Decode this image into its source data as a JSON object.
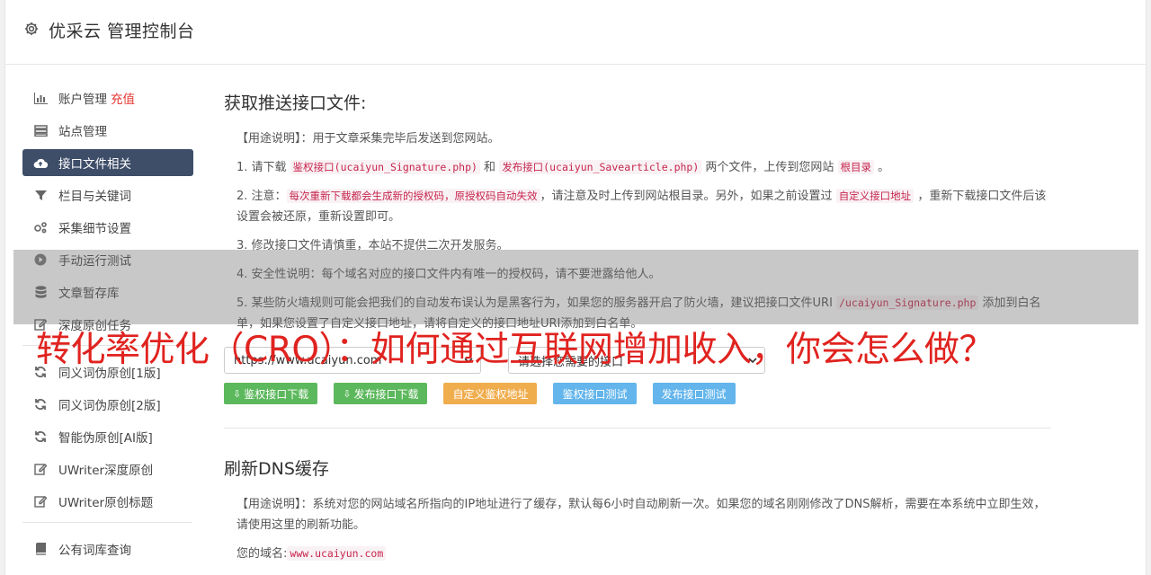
{
  "header": {
    "title": "优采云 管理控制台",
    "icon": "gear-icon"
  },
  "sidebar": {
    "items": [
      {
        "label": "账户管理",
        "extra": "充值",
        "icon": "bar-chart-icon"
      },
      {
        "label": "站点管理",
        "icon": "server-icon"
      },
      {
        "label": "接口文件相关",
        "icon": "cloud-upload-icon",
        "active": true
      },
      {
        "label": "栏目与关键词",
        "icon": "filter-icon"
      },
      {
        "label": "采集细节设置",
        "icon": "cogs-icon"
      },
      {
        "label": "手动运行测试",
        "icon": "play-circle-icon"
      },
      {
        "label": "文章暂存库",
        "icon": "database-icon"
      },
      {
        "label": "深度原创任务",
        "icon": "edit-icon"
      },
      {
        "label": "同义词伪原创[1版]",
        "icon": "refresh-icon"
      },
      {
        "label": "同义词伪原创[2版]",
        "icon": "refresh-icon"
      },
      {
        "label": "智能伪原创[AI版]",
        "icon": "refresh-icon"
      },
      {
        "label": "UWriter深度原创",
        "icon": "edit-icon"
      },
      {
        "label": "UWriter原创标题",
        "icon": "edit-icon"
      },
      {
        "label": "公有词库查询",
        "icon": "book-icon"
      }
    ]
  },
  "section1": {
    "title": "获取推送接口文件:",
    "usage_label": "【用途说明】",
    "usage_text": "：用于文章采集完毕后发送到您网站。",
    "p1_a": "1. 请下载 ",
    "p1_code1": "鉴权接口(ucaiyun_Signature.php)",
    "p1_b": " 和 ",
    "p1_code2": "发布接口(ucaiyun_Savearticle.php)",
    "p1_c": " 两个文件，上传到您网站 ",
    "p1_code3": "根目录",
    "p1_d": " 。",
    "p2_a": "2. 注意：",
    "p2_code1": "每次重新下载都会生成新的授权码，原授权码自动失效",
    "p2_b": "，请注意及时上传到网站根目录。另外，如果之前设置过 ",
    "p2_code2": "自定义接口地址",
    "p2_c": " ，重新下载接口文件后该设置会被还原，重新设置即可。",
    "p3": "3. 修改接口文件请慎重，本站不提供二次开发服务。",
    "p4": "4. 安全性说明：每个域名对应的接口文件内有唯一的授权码，请不要泄露给他人。",
    "p5_a": "5. 某些防火墙规则可能会把我们的自动发布误认为是黑客行为，如果您的服务器开启了防火墙，建议把接口文件URI ",
    "p5_code": "/ucaiyun_Signature.php",
    "p5_b": " 添加到白名单，如果您设置了自定义接口地址，请将自定义的接口地址URI添加到白名单。",
    "select_site": "https://www.ucaiyun.com",
    "select_api": "请选择您需要的接口",
    "btn_auth_download": "鉴权接口下载",
    "btn_publish_download": "发布接口下载",
    "btn_custom_auth": "自定义鉴权地址",
    "btn_auth_test": "鉴权接口测试",
    "btn_publish_test": "发布接口测试"
  },
  "section2": {
    "title": "刷新DNS缓存",
    "usage_label": "【用途说明】",
    "usage_text": "：系统对您的网站域名所指向的IP地址进行了缓存，默认每6小时自动刷新一次。如果您的域名刚刚修改了DNS解析，需要在本系统中立即生效，请使用这里的刷新功能。",
    "domain_label": "您的域名:",
    "domain_value": "www.ucaiyun.com"
  },
  "overlay_headline": "转化率优化（CRO）：如何通过互联网增加收入，你会怎么做？",
  "colors": {
    "active_nav": "#3e4d68",
    "green": "#5cb85c",
    "orange": "#f0ad4e",
    "blue": "#63b5ec",
    "headline": "#e0231f"
  }
}
